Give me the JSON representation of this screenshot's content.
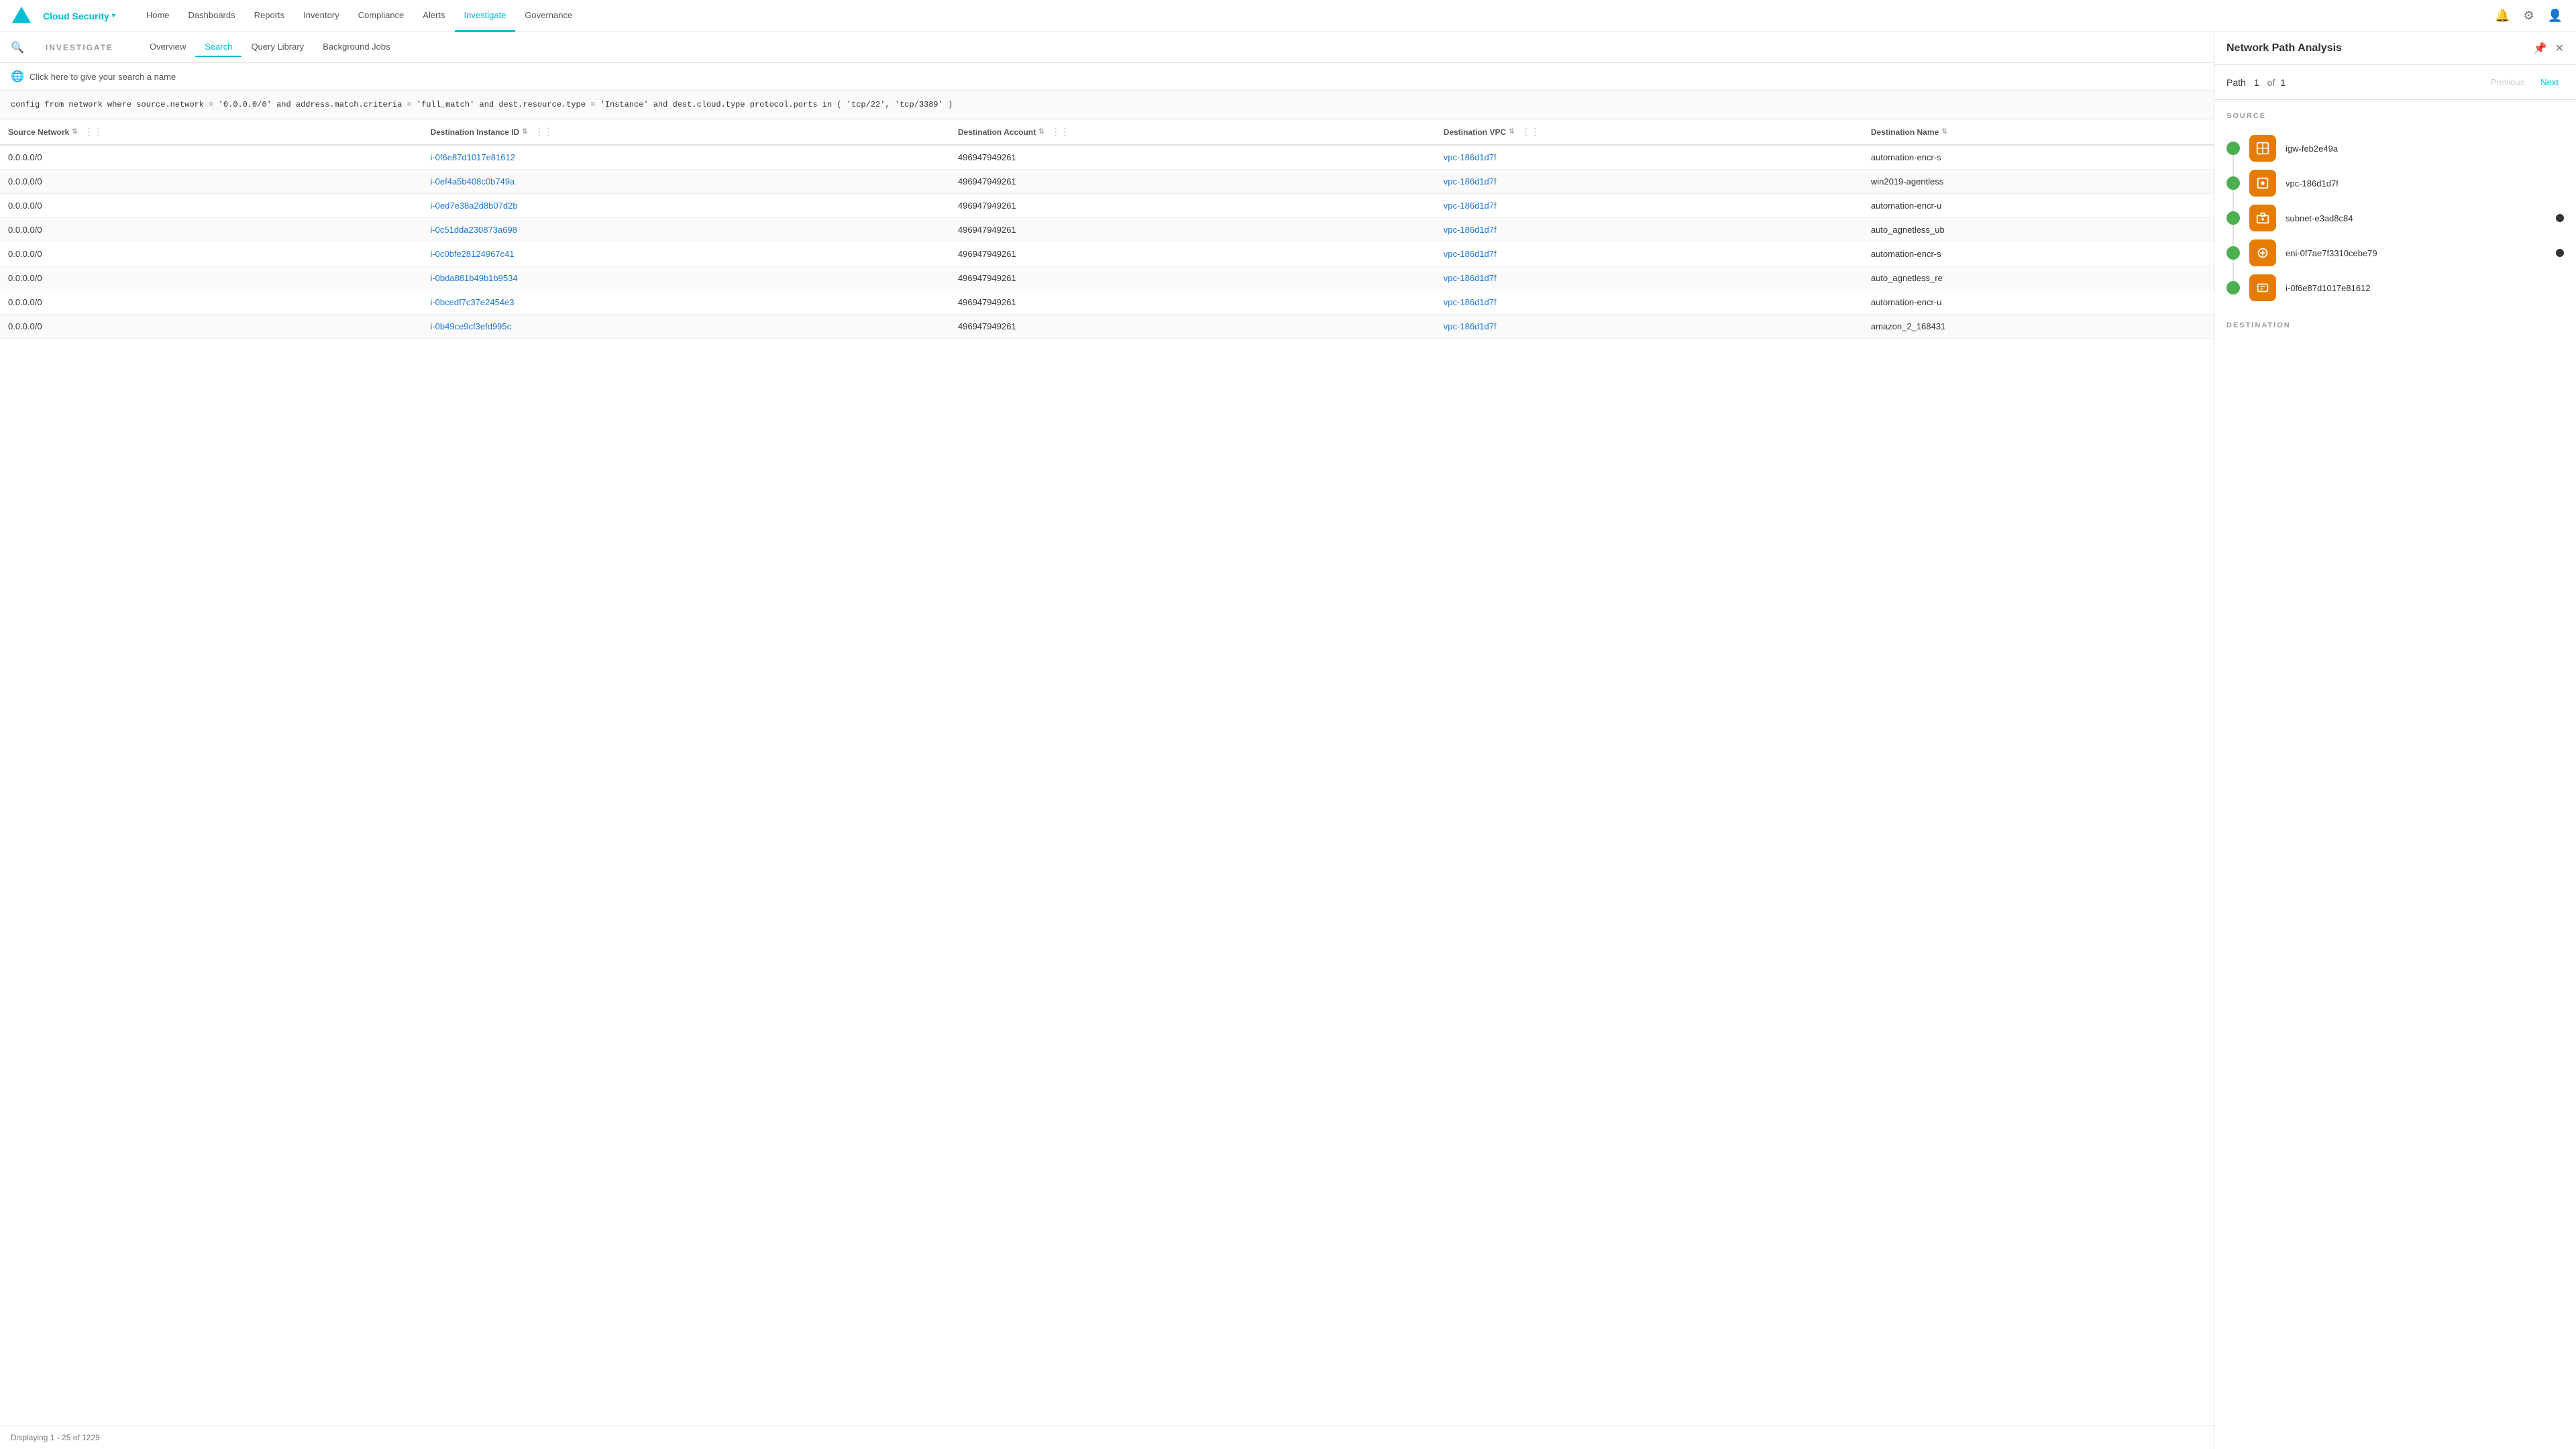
{
  "app": {
    "logo_icon": "◆",
    "brand": "Cloud Security",
    "brand_chevron": "▾"
  },
  "nav": {
    "items": [
      {
        "label": "Home",
        "active": false
      },
      {
        "label": "Dashboards",
        "active": false
      },
      {
        "label": "Reports",
        "active": false
      },
      {
        "label": "Inventory",
        "active": false
      },
      {
        "label": "Compliance",
        "active": false
      },
      {
        "label": "Alerts",
        "active": false
      },
      {
        "label": "Investigate",
        "active": true
      },
      {
        "label": "Governance",
        "active": false
      }
    ]
  },
  "investigate": {
    "label": "INVESTIGATE",
    "tabs": [
      {
        "label": "Overview",
        "active": false
      },
      {
        "label": "Search",
        "active": true
      },
      {
        "label": "Query Library",
        "active": false
      },
      {
        "label": "Background Jobs",
        "active": false
      }
    ]
  },
  "search_name": {
    "placeholder": "Click here to give your search a name"
  },
  "query": {
    "text": "config from network where source.network = '0.0.0.0/0' and address.match.criteria = 'full_match' and dest.resource.type = 'Instance' and dest.cloud.type protocol.ports in ( 'tcp/22', 'tcp/3389' )"
  },
  "table": {
    "columns": [
      {
        "label": "Source Network",
        "sortable": true
      },
      {
        "label": "Destination Instance ID",
        "sortable": true
      },
      {
        "label": "Destination Account",
        "sortable": true
      },
      {
        "label": "Destination VPC",
        "sortable": true
      },
      {
        "label": "Destination Name",
        "sortable": true
      }
    ],
    "rows": [
      {
        "source_network": "0.0.0.0/0",
        "dest_instance_id": "i-0f6e87d1017e81612",
        "dest_account": "496947949261",
        "dest_vpc": "vpc-186d1d7f",
        "dest_name": "automation-encr-s"
      },
      {
        "source_network": "0.0.0.0/0",
        "dest_instance_id": "i-0ef4a5b408c0b749a",
        "dest_account": "496947949261",
        "dest_vpc": "vpc-186d1d7f",
        "dest_name": "win2019-agentless"
      },
      {
        "source_network": "0.0.0.0/0",
        "dest_instance_id": "i-0ed7e38a2d8b07d2b",
        "dest_account": "496947949261",
        "dest_vpc": "vpc-186d1d7f",
        "dest_name": "automation-encr-u"
      },
      {
        "source_network": "0.0.0.0/0",
        "dest_instance_id": "i-0c51dda230873a698",
        "dest_account": "496947949261",
        "dest_vpc": "vpc-186d1d7f",
        "dest_name": "auto_agnetless_ub"
      },
      {
        "source_network": "0.0.0.0/0",
        "dest_instance_id": "i-0c0bfe28124967c41",
        "dest_account": "496947949261",
        "dest_vpc": "vpc-186d1d7f",
        "dest_name": "automation-encr-s"
      },
      {
        "source_network": "0.0.0.0/0",
        "dest_instance_id": "i-0bda881b49b1b9534",
        "dest_account": "496947949261",
        "dest_vpc": "vpc-186d1d7f",
        "dest_name": "auto_agnetless_re"
      },
      {
        "source_network": "0.0.0.0/0",
        "dest_instance_id": "i-0bcedf7c37e2454e3",
        "dest_account": "496947949261",
        "dest_vpc": "vpc-186d1d7f",
        "dest_name": "automation-encr-u"
      },
      {
        "source_network": "0.0.0.0/0",
        "dest_instance_id": "i-0b49ce9cf3efd995c",
        "dest_account": "496947949261",
        "dest_vpc": "vpc-186d1d7f",
        "dest_name": "amazon_2_168431"
      }
    ],
    "footer": "Displaying 1 - 25 of 1229"
  },
  "panel": {
    "title": "Network Path Analysis",
    "path_label": "Path",
    "path_current": "1",
    "path_of": "of",
    "path_total": "1",
    "prev_label": "Previous",
    "next_label": "Next",
    "source_section_label": "SOURCE",
    "destination_section_label": "DESTINATION",
    "path_items": [
      {
        "name": "igw-feb2e49a",
        "icon_type": "internet-gateway",
        "has_extra": false
      },
      {
        "name": "vpc-186d1d7f",
        "icon_type": "vpc",
        "has_extra": false
      },
      {
        "name": "subnet-e3ad8c84",
        "icon_type": "subnet",
        "has_extra": true
      },
      {
        "name": "eni-0f7ae7f3310cebe79",
        "icon_type": "eni",
        "has_extra": true
      },
      {
        "name": "i-0f6e87d1017e81612",
        "icon_type": "instance",
        "has_extra": false
      }
    ]
  },
  "colors": {
    "accent": "#00bcd4",
    "orange": "#e57c00",
    "green": "#4caf50",
    "link": "#1976d2"
  }
}
